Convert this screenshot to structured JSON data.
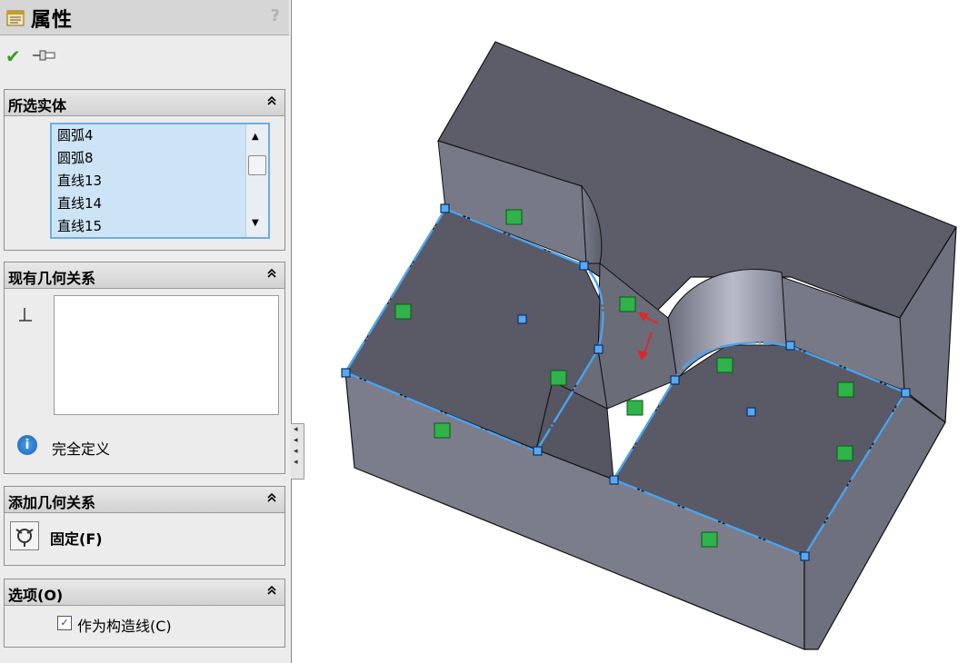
{
  "panel": {
    "title": "属性",
    "help": "?",
    "ok_symbol": "✔",
    "selected_entities": {
      "title": "所选实体",
      "collapse": "⌃",
      "items": [
        "圆弧4",
        "圆弧8",
        "直线13",
        "直线14",
        "直线15"
      ]
    },
    "existing_relations": {
      "title": "现有几何关系",
      "collapse": "⌃",
      "status_icon_text": "i",
      "status_text": "完全定义"
    },
    "add_relations": {
      "title": "添加几何关系",
      "collapse": "⌃",
      "fix_label": "固定(F)"
    },
    "options": {
      "title": "选项(O)",
      "collapse": "⌃",
      "construction_label": "作为构造线(C)",
      "construction_checked": true,
      "check_mark": "✓"
    },
    "side_tab_arrows": [
      "◂",
      "◂",
      "◂",
      "◂"
    ]
  },
  "colors": {
    "panel_bg": "#ececec",
    "list_bg": "#cde4f7",
    "list_border": "#6aaee6",
    "sketch_line": "#4aa3ef",
    "face_top": "#5a5a66",
    "face_front": "#787a88",
    "fixed_marker": "#2fb34a",
    "arrow_red": "#e0262b"
  },
  "icons": {
    "title": "properties-icon",
    "ok": "checkmark-icon",
    "pin": "pushpin-icon",
    "help": "help-icon",
    "collapse": "chevron-up-icon",
    "perpendicular": "perpendicular-icon",
    "info": "info-icon",
    "fix": "fix-anchor-icon",
    "fixed_marker": "fixed-relation-icon"
  }
}
